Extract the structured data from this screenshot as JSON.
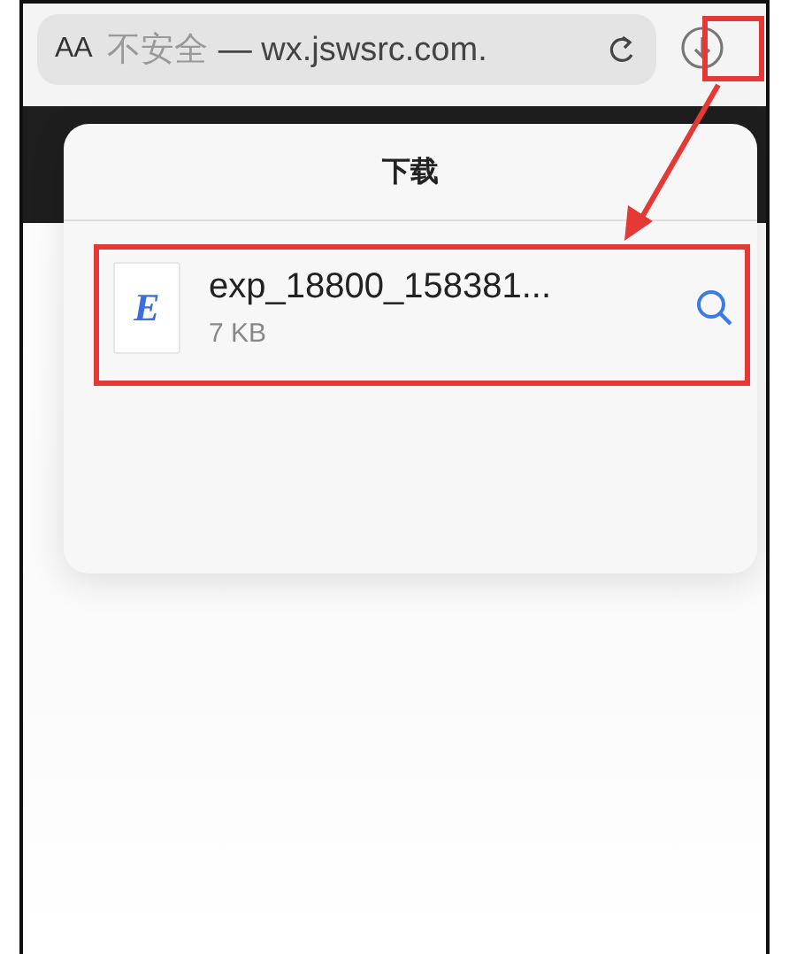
{
  "address_bar": {
    "text_size_button": "AA",
    "security_label": "不安全",
    "separator": "—",
    "url": "wx.jswsrc.com."
  },
  "downloads_popover": {
    "title": "下载",
    "items": [
      {
        "name": "exp_18800_158381...",
        "size": "7 KB",
        "file_badge": "E"
      }
    ]
  },
  "annotations": [
    {
      "kind": "button_box"
    },
    {
      "kind": "item_box"
    },
    {
      "kind": "arrow"
    }
  ]
}
